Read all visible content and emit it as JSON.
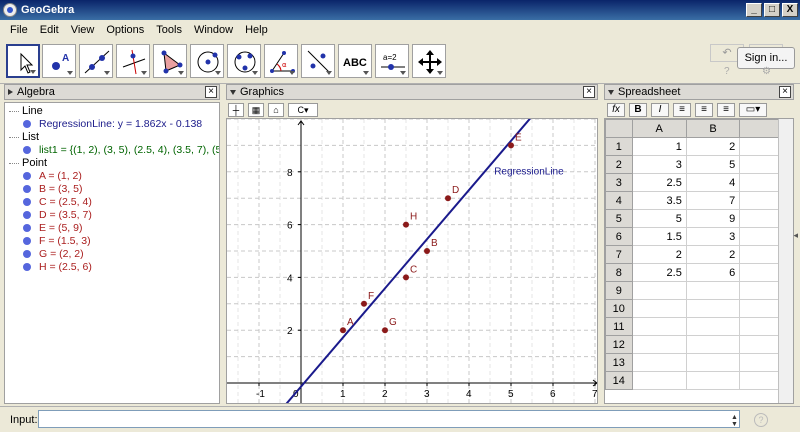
{
  "window": {
    "title": "GeoGebra",
    "btn_min": "_",
    "btn_max": "□",
    "btn_close": "X"
  },
  "menu": [
    "File",
    "Edit",
    "View",
    "Options",
    "Tools",
    "Window",
    "Help"
  ],
  "toolbar": {
    "signin": "Sign in...",
    "undo": "↶",
    "redo": "↷",
    "help": "?",
    "settings": "⚙",
    "text_tool": "ABC",
    "slider_tool": "a=2"
  },
  "algebra": {
    "title": "Algebra",
    "categories": {
      "line": "Line",
      "list": "List",
      "point": "Point"
    },
    "line": "RegressionLine: y = 1.862x - 0.138",
    "list": "list1 = {(1, 2), (3, 5), (2.5, 4), (3.5, 7), (5,",
    "points": [
      "A = (1, 2)",
      "B = (3, 5)",
      "C = (2.5, 4)",
      "D = (3.5, 7)",
      "E = (5, 9)",
      "F = (1.5, 3)",
      "G = (2, 2)",
      "H = (2.5, 6)"
    ]
  },
  "graphics": {
    "title": "Graphics",
    "line_label": "RegressionLine",
    "points": [
      {
        "name": "A",
        "x": 1,
        "y": 2
      },
      {
        "name": "B",
        "x": 3,
        "y": 5
      },
      {
        "name": "C",
        "x": 2.5,
        "y": 4
      },
      {
        "name": "D",
        "x": 3.5,
        "y": 7
      },
      {
        "name": "E",
        "x": 5,
        "y": 9
      },
      {
        "name": "F",
        "x": 1.5,
        "y": 3
      },
      {
        "name": "G",
        "x": 2,
        "y": 2
      },
      {
        "name": "H",
        "x": 2.5,
        "y": 6
      }
    ],
    "slope": 1.862,
    "intercept": -0.138,
    "x_ticks": [
      "-1",
      "0",
      "1",
      "2",
      "3",
      "4",
      "5",
      "6",
      "7"
    ],
    "y_ticks": [
      "2",
      "4",
      "6",
      "8"
    ]
  },
  "spreadsheet": {
    "title": "Spreadsheet",
    "fx": "fx",
    "bold": "B",
    "italic": "I",
    "columns": [
      "A",
      "B"
    ],
    "rows": [
      [
        "1",
        "1",
        "2"
      ],
      [
        "2",
        "3",
        "5"
      ],
      [
        "3",
        "2.5",
        "4"
      ],
      [
        "4",
        "3.5",
        "7"
      ],
      [
        "5",
        "5",
        "9"
      ],
      [
        "6",
        "1.5",
        "3"
      ],
      [
        "7",
        "2",
        "2"
      ],
      [
        "8",
        "2.5",
        "6"
      ],
      [
        "9",
        "",
        ""
      ],
      [
        "10",
        "",
        ""
      ],
      [
        "11",
        "",
        ""
      ],
      [
        "12",
        "",
        ""
      ],
      [
        "13",
        "",
        ""
      ],
      [
        "14",
        "",
        ""
      ]
    ]
  },
  "input": {
    "label": "Input:",
    "value": "",
    "help": "?"
  }
}
